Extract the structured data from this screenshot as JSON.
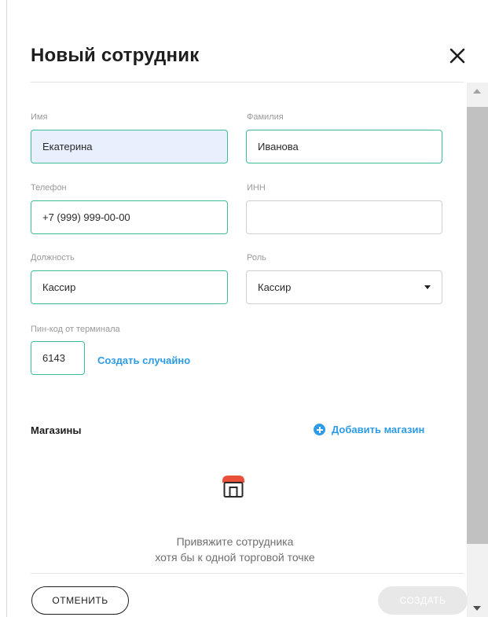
{
  "modal": {
    "title": "Новый сотрудник",
    "close_icon": "close-icon"
  },
  "form": {
    "first_name": {
      "label": "Имя",
      "value": "Екатерина"
    },
    "last_name": {
      "label": "Фамилия",
      "value": "Иванова"
    },
    "phone": {
      "label": "Телефон",
      "value": "+7 (999) 999-00-00"
    },
    "inn": {
      "label": "ИНН",
      "value": ""
    },
    "position": {
      "label": "Должность",
      "value": "Кассир"
    },
    "role": {
      "label": "Роль",
      "value": "Кассир"
    },
    "pin": {
      "label": "Пин-код от терминала",
      "value": "6143",
      "generate_label": "Создать случайно"
    }
  },
  "stores": {
    "title": "Магазины",
    "add_label": "Добавить магазин",
    "empty_line1": "Привяжите сотрудника",
    "empty_line2": "хотя бы к одной торговой точке",
    "empty_icon": "store-icon"
  },
  "footer": {
    "cancel_label": "ОТМЕНИТЬ",
    "create_label": "СОЗДАТЬ"
  },
  "colors": {
    "accent_border": "#3dbd9a",
    "link": "#2d9be6",
    "autofill_bg": "#e8f0fd",
    "store_roof": "#e8503a"
  }
}
